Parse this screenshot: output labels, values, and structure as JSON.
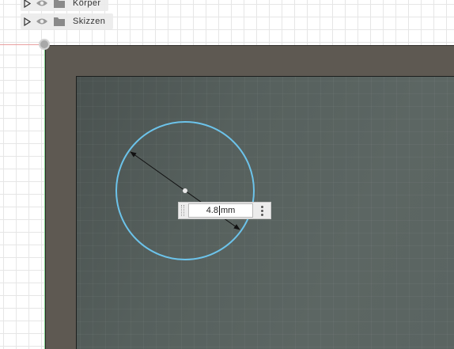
{
  "browser": {
    "items": [
      {
        "label": "Körper",
        "icon": "folder-icon",
        "visibility_icon": "eye-icon",
        "expander_icon": "expand-triangle-icon"
      },
      {
        "label": "Skizzen",
        "icon": "folder-icon",
        "visibility_icon": "eye-icon",
        "expander_icon": "expand-triangle-icon"
      }
    ]
  },
  "sketch": {
    "shape": "circle",
    "circle_color": "#6cc3ea"
  },
  "dimension_input": {
    "value": "4.8",
    "unit": "mm",
    "menu_icon": "more-vertical-icon"
  },
  "colors": {
    "body_face": "#5e5952",
    "inner_face": "#56605d",
    "x_axis": "#e8a0a0",
    "y_axis": "#7fd08c"
  }
}
